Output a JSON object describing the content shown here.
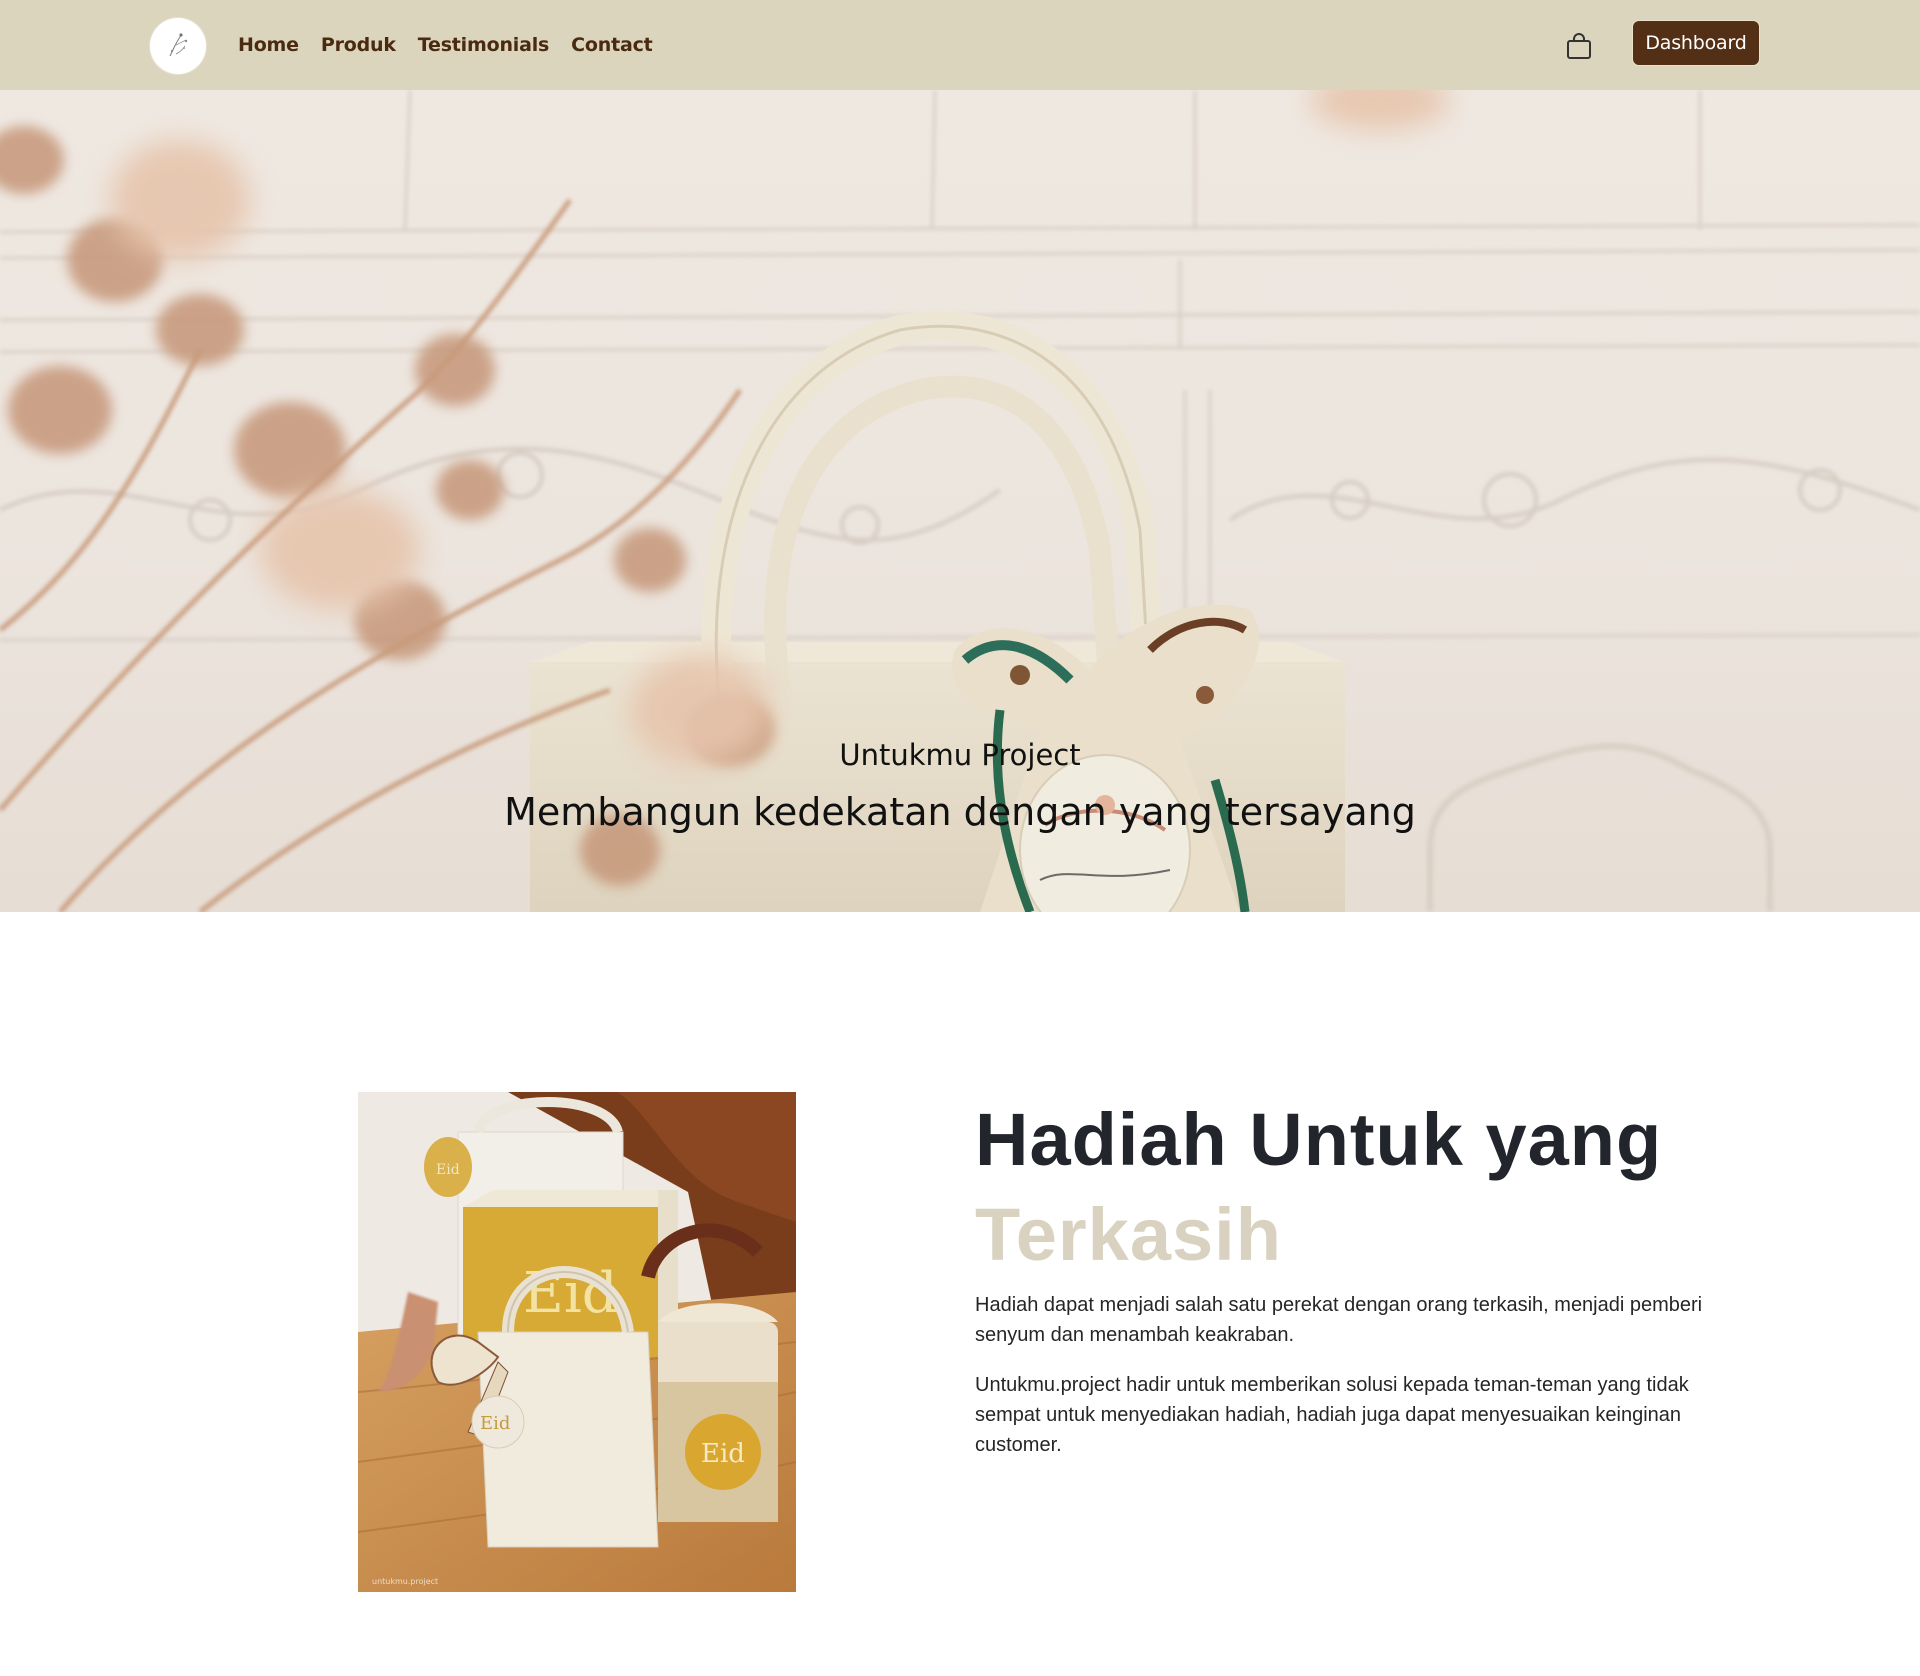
{
  "nav": {
    "links": [
      "Home",
      "Produk",
      "Testimonials",
      "Contact"
    ],
    "dashboard_label": "Dashboard",
    "logo_icon": "logo-sketch-icon",
    "cart_icon": "shopping-bag-icon"
  },
  "hero": {
    "subtitle": "Untukmu Project",
    "title": "Membangun kedekatan dengan yang tersayang"
  },
  "about": {
    "heading_line1": "Hadiah Untuk yang",
    "heading_line2": "Terkasih",
    "paragraph1": "Hadiah dapat menjadi salah satu perekat dengan orang terkasih, menjadi pemberi senyum dan menambah keakraban.",
    "paragraph2": "Untukmu.project hadir untuk memberikan solusi kepada teman-teman yang tidak sempat untuk menyediakan hadiah, hadiah juga dapat menyesuaikan keinginan customer."
  },
  "colors": {
    "navbar_bg": "#dcd5be",
    "nav_text": "#4a2a10",
    "button_bg": "#532f16",
    "heading_dark": "#22262c",
    "heading_accent": "#d9d2c0"
  }
}
